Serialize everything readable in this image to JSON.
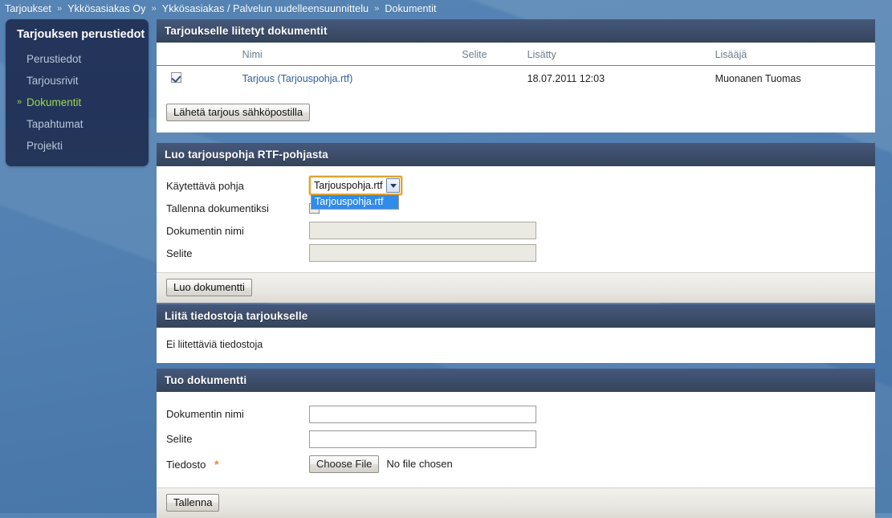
{
  "breadcrumb": {
    "separator": "»",
    "items": [
      "Tarjoukset",
      "Ykkösasiakas Oy",
      "Ykkösasiakas / Palvelun uudelleensuunnittelu",
      "Dokumentit"
    ]
  },
  "sidebar": {
    "title": "Tarjouksen perustiedot",
    "active_marker": "»",
    "items": [
      {
        "label": "Perustiedot",
        "active": false
      },
      {
        "label": "Tarjousrivit",
        "active": false
      },
      {
        "label": "Dokumentit",
        "active": true
      },
      {
        "label": "Tapahtumat",
        "active": false
      },
      {
        "label": "Projekti",
        "active": false
      }
    ]
  },
  "documents_panel": {
    "title": "Tarjoukselle liitetyt dokumentit",
    "columns": [
      "",
      "Nimi",
      "Selite",
      "Lisätty",
      "Lisääjä"
    ],
    "rows": [
      {
        "checked": true,
        "name": "Tarjous (Tarjouspohja.rtf)",
        "selite": "",
        "added": "18.07.2011 12:03",
        "added_by": "Muonanen Tuomas"
      }
    ],
    "send_button": "Lähetä tarjous sähköpostilla"
  },
  "rtf_panel": {
    "title": "Luo tarjouspohja RTF-pohjasta",
    "fields": {
      "template_label": "Käytettävä pohja",
      "save_as_doc_label": "Tallenna dokumentiksi",
      "save_as_doc_checked": false,
      "doc_name_label": "Dokumentin nimi",
      "doc_name_value": "",
      "selite_label": "Selite",
      "selite_value": ""
    },
    "template_select": {
      "selected": "Tarjouspohja.rtf",
      "open": true,
      "options": [
        "Tarjouspohja.rtf"
      ]
    },
    "create_button": "Luo dokumentti"
  },
  "attach_panel": {
    "title": "Liitä tiedostoja tarjoukselle",
    "empty_message": "Ei liitettäviä tiedostoja"
  },
  "import_panel": {
    "title": "Tuo dokumentti",
    "doc_name_label": "Dokumentin nimi",
    "doc_name_value": "",
    "selite_label": "Selite",
    "selite_value": "",
    "file_label": "Tiedosto",
    "file_required_marker": "*",
    "file_button": "Choose File",
    "file_status": "No file chosen",
    "save_button": "Tallenna"
  },
  "colors": {
    "page_background": "#4f7db0",
    "panel_header": "#3e4f6e",
    "sidebar": "#24355a",
    "active_nav": "#9cd84a",
    "link": "#2e5fa3",
    "required": "#e8883a",
    "select_focus": "#e0a32e",
    "option_highlight": "#2f8cea"
  }
}
